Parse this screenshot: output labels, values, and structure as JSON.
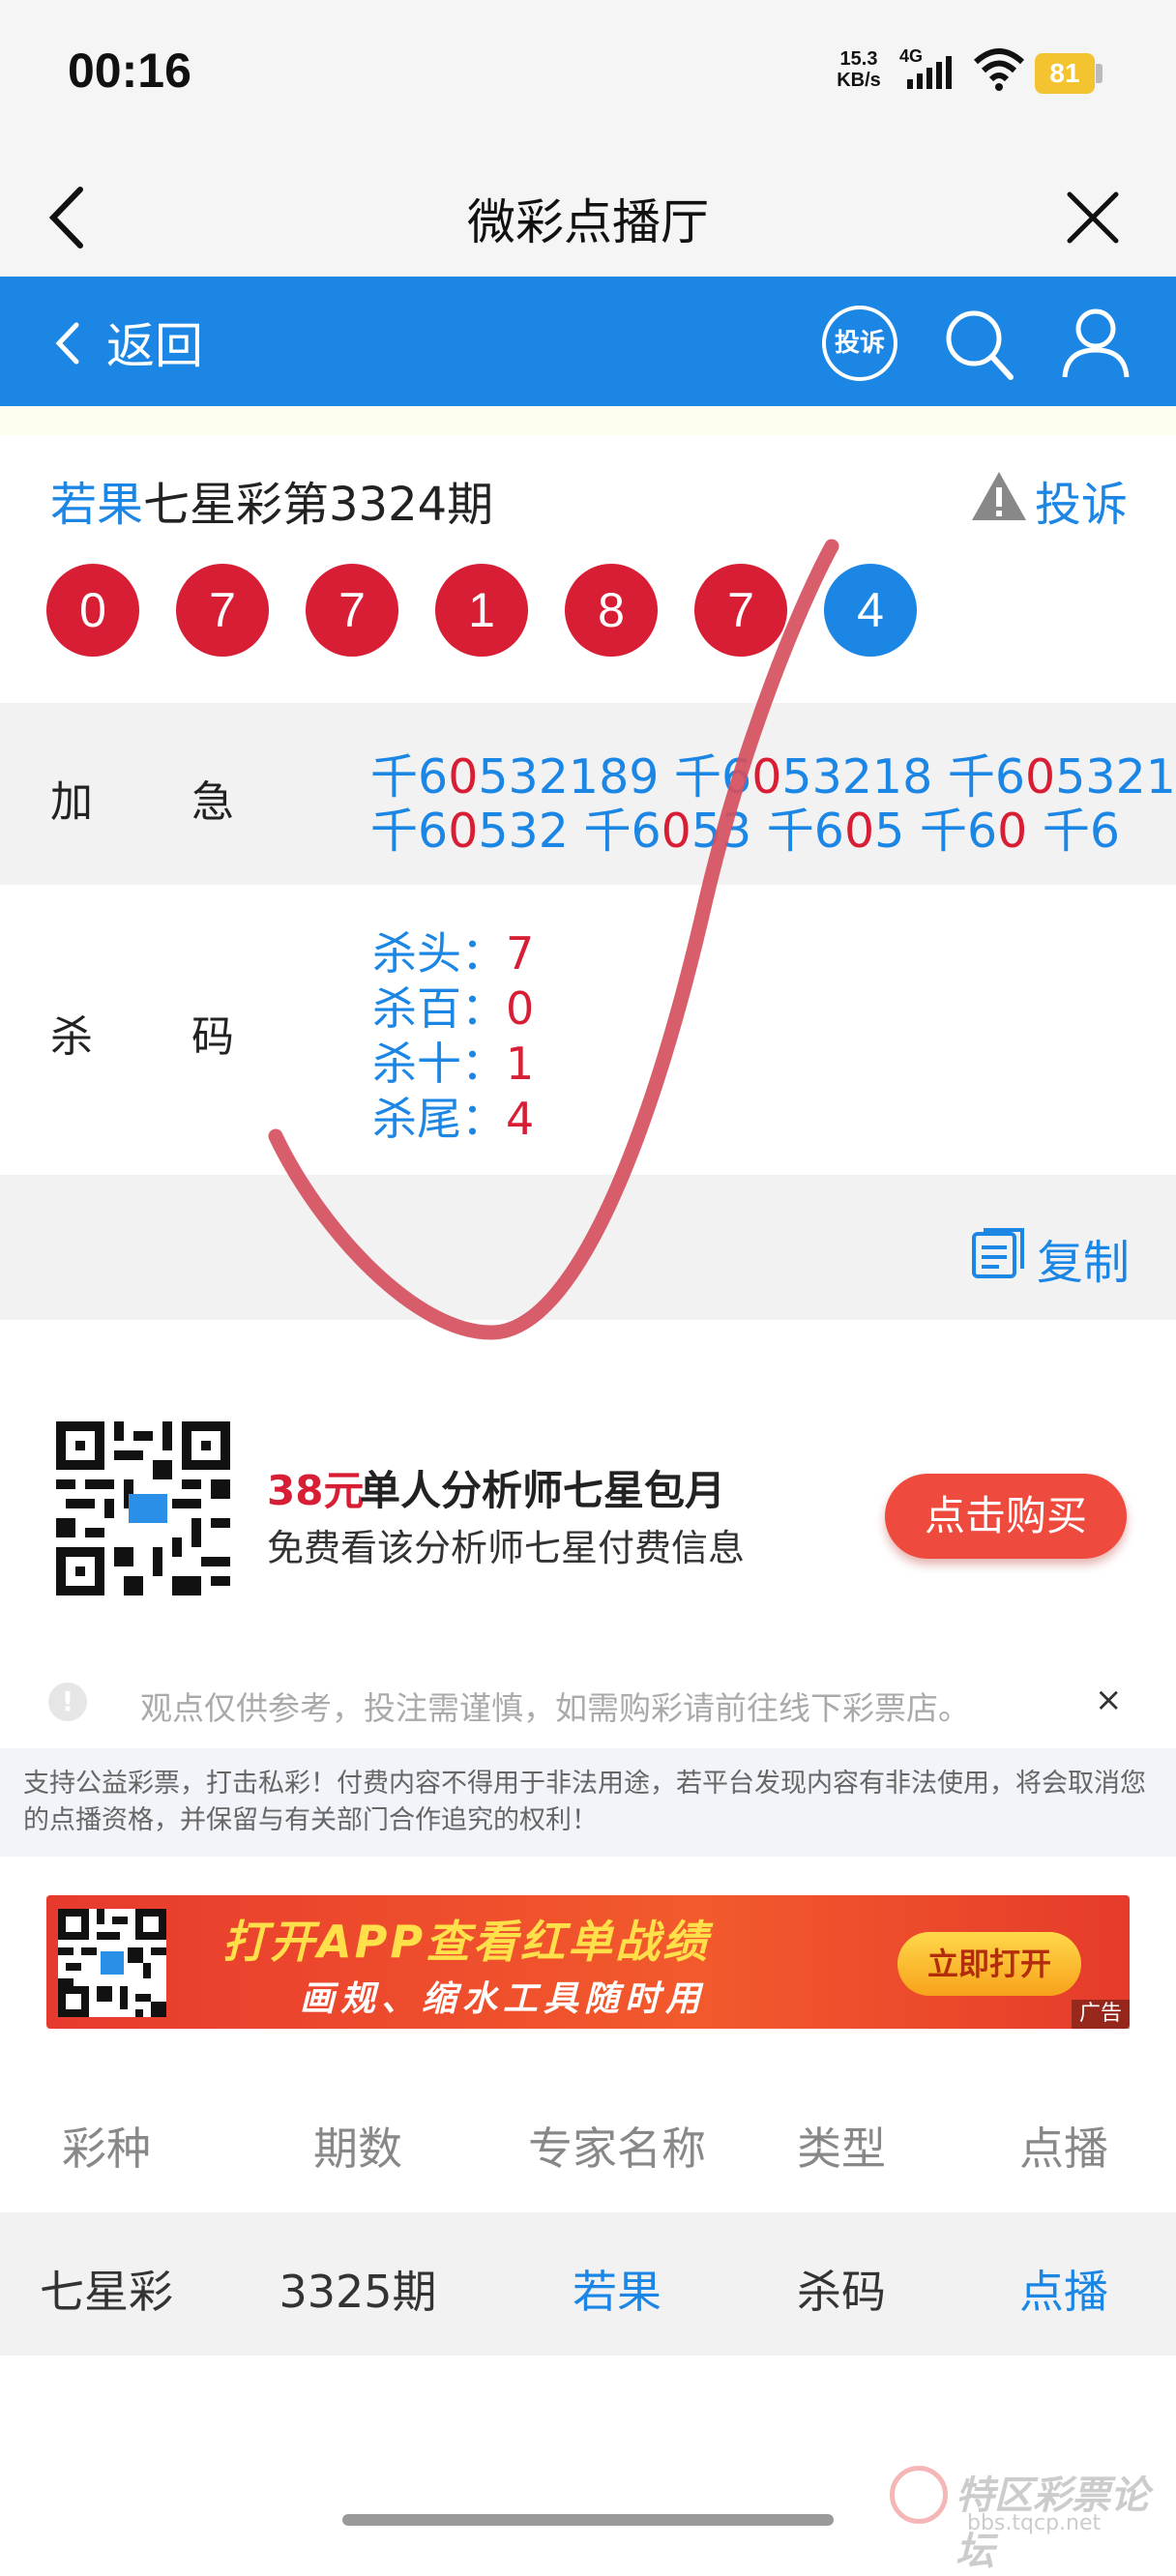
{
  "status_bar": {
    "time": "00:16",
    "net_speed": "15.3",
    "net_unit": "KB/s",
    "network": "4G",
    "battery": "81"
  },
  "title_bar": {
    "title": "微彩点播厅"
  },
  "nav": {
    "back_label": "返回",
    "complaint_icon_text": "投诉"
  },
  "header": {
    "expert": "若果",
    "lottery_issue": "七星彩第3324期",
    "complain_label": "投诉"
  },
  "balls": [
    {
      "num": "0",
      "color": "red"
    },
    {
      "num": "7",
      "color": "red"
    },
    {
      "num": "7",
      "color": "red"
    },
    {
      "num": "1",
      "color": "red"
    },
    {
      "num": "8",
      "color": "red"
    },
    {
      "num": "7",
      "color": "red"
    },
    {
      "num": "4",
      "color": "blue"
    }
  ],
  "rows": {
    "jiaji_label_1": "加",
    "jiaji_label_2": "急",
    "jiaji_line1": [
      {
        "a": "千6",
        "b": "0",
        "c": "532189"
      },
      {
        "a": "千6",
        "b": "0",
        "c": "53218"
      },
      {
        "a": "千6",
        "b": "0",
        "c": "5321"
      }
    ],
    "jiaji_line2": [
      {
        "a": "千6",
        "b": "0",
        "c": "532"
      },
      {
        "a": "千6",
        "b": "0",
        "c": "53"
      },
      {
        "a": "千6",
        "b": "0",
        "c": "5"
      },
      {
        "a": "千6",
        "b": "0",
        "c": ""
      },
      {
        "a": "千6",
        "b": "",
        "c": ""
      }
    ],
    "shama_label_1": "杀",
    "shama_label_2": "码",
    "kills": [
      {
        "label": "杀头：",
        "value": "7"
      },
      {
        "label": "杀百：",
        "value": "0"
      },
      {
        "label": "杀十：",
        "value": "1"
      },
      {
        "label": "杀尾：",
        "value": "4"
      }
    ],
    "copy_label": "复制"
  },
  "promo": {
    "price": "38元",
    "title": "单人分析师七星包月",
    "subtitle": "免费看该分析师七星付费信息",
    "buy_label": "点击购买"
  },
  "disclaimer": {
    "text": "观点仅供参考，投注需谨慎，如需购彩请前往线下彩票店。",
    "close": "×",
    "notice": "支持公益彩票，打击私彩！付费内容不得用于非法用途，若平台发现内容有非法使用，将会取消您的点播资格，并保留与有关部门合作追究的权利！"
  },
  "banner": {
    "title": "打开APP查看红单战绩",
    "subtitle": "画规、缩水工具随时用",
    "button": "立即打开",
    "ad": "广告"
  },
  "table": {
    "headers": [
      "彩种",
      "期数",
      "专家名称",
      "类型",
      "点播"
    ],
    "row": [
      "七星彩",
      "3325期",
      "若果",
      "杀码",
      "点播"
    ]
  },
  "watermark": {
    "text": "特区彩票论坛",
    "url": "bbs.tqcp.net"
  },
  "colors": {
    "brand_blue": "#1c86e5",
    "ball_red": "#d81e35",
    "nav_blue": "#1c86e5"
  }
}
